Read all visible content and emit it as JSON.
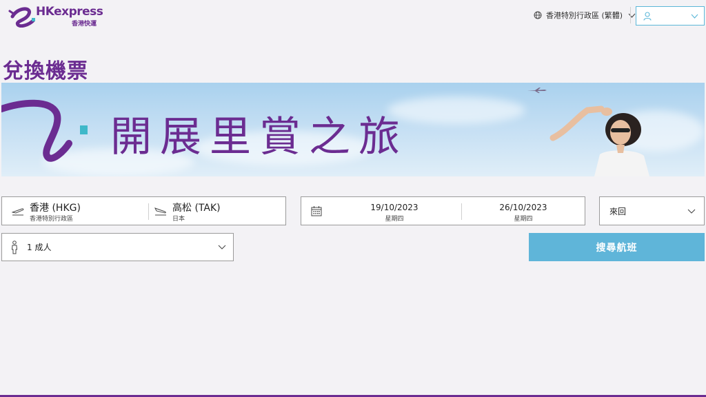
{
  "header": {
    "logo_brand": "HKexpress",
    "logo_sub": "香港快運",
    "language_label": "香港特別行政區 (繁體)"
  },
  "page": {
    "title": "兌換機票"
  },
  "banner": {
    "headline": "開展里賞之旅"
  },
  "booking": {
    "origin_code": "香港 (HKG)",
    "origin_region": "香港特別行政區",
    "destination_code": "高松 (TAK)",
    "destination_region": "日本",
    "depart_date": "19/10/2023",
    "depart_weekday": "星期四",
    "return_date": "26/10/2023",
    "return_weekday": "星期四",
    "trip_type": "來回",
    "passengers": "1 成人",
    "search_label": "搜尋航班"
  },
  "colors": {
    "brand_purple": "#6b2c91",
    "search_blue": "#5fb5d9",
    "accent_teal": "#3fb8c9"
  }
}
